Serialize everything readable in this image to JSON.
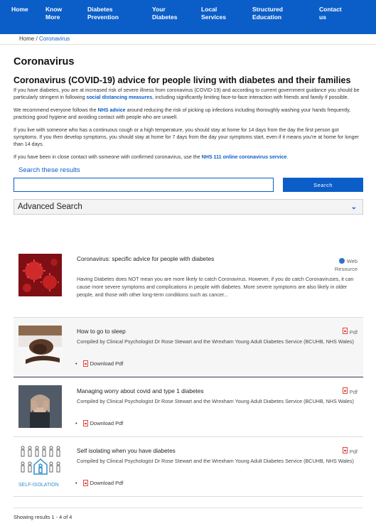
{
  "nav": [
    {
      "line1": "Home",
      "line2": ""
    },
    {
      "line1": "Know",
      "line2": "More"
    },
    {
      "line1": "Diabetes",
      "line2": "Prevention"
    },
    {
      "line1": "Your",
      "line2": "Diabetes"
    },
    {
      "line1": "Local",
      "line2": "Services"
    },
    {
      "line1": "Structured",
      "line2": "Education"
    },
    {
      "line1": "Contact",
      "line2": "us"
    }
  ],
  "breadcrumb": {
    "home": "Home",
    "sep": "/",
    "current": "Coronavirus"
  },
  "page_title": "Coronavirus",
  "subtitle": "Coronavirus (COVID-19) advice for people living with diabetes and their families",
  "paras": {
    "p1_a": "If you have diabetes, you are at increased risk of severe illness from coronavirus (COVID-19) and according to current government guidance you should be particularly stringent in following ",
    "p1_link": "social distancing measures",
    "p1_b": ", including significantly limiting face-to-face interaction with friends and family if possible.",
    "p2_a": "We recommend everyone follows the ",
    "p2_link": "NHS advice",
    "p2_b": " around reducing the risk of picking up infections including thoroughly washing your hands frequently, practicing good hygiene and avoiding contact with people who are unwell.",
    "p3": "If you live with someone who has a continuous cough or a high temperature, you should stay at home for 14 days from the day the first person got symptoms. If you then develop symptoms, you should stay at home for 7 days from the day your symptoms start, even if it means you're at home for longer than 14 days.",
    "p4_a": "If you have been in close contact with someone with confirmed coronavirus, use the ",
    "p4_link": "NHS 111 online coronavirus service",
    "p4_b": "."
  },
  "search": {
    "label": "Search these results",
    "placeholder": "",
    "button": "Search"
  },
  "advanced": {
    "label": "Advanced Search"
  },
  "results": [
    {
      "title": "Coronavirus: specific advice for people with diabetes",
      "type_line1": "Web",
      "type_line2": "Resource",
      "desc": "Having Diabetes does NOT mean you are more likely to catch Coronavirus. However, if you do catch Coronaviruses, it can cause more severe symptoms and complications in people with diabetes. More severe symptoms are also likely in older people, and those with other long-term conditions such as cancer..."
    },
    {
      "title": "How to go to sleep",
      "type": "Pdf",
      "desc": "Compiled by Clinical Psychologist Dr Rose Stewart and the Wrexham Young Adult Diabetes Service (BCUHB, NHS Wales)",
      "download": "Download Pdf"
    },
    {
      "title": "Managing worry about covid and type 1 diabetes",
      "type": "Pdf",
      "desc": "Compiled by Clinical Psychologist Dr Rose Stewart and the Wrexham Young Adult Diabetes Service (BCUHB, NHS Wales)",
      "download": "Download Pdf"
    },
    {
      "title": "Self isolating when you have diabetes",
      "type": "Pdf",
      "desc": "Compiled by Clinical Psychologist Dr Rose Stewart and the Wrexham Young Adult Diabetes Service (BCUHB, NHS Wales)",
      "download": "Download Pdf",
      "thumb_text": "SELF-ISOLATION"
    }
  ],
  "footer": "Showing results 1 - 4 of 4",
  "colors": {
    "brand": "#0b5ec8",
    "pdf_red": "#e0443b"
  }
}
